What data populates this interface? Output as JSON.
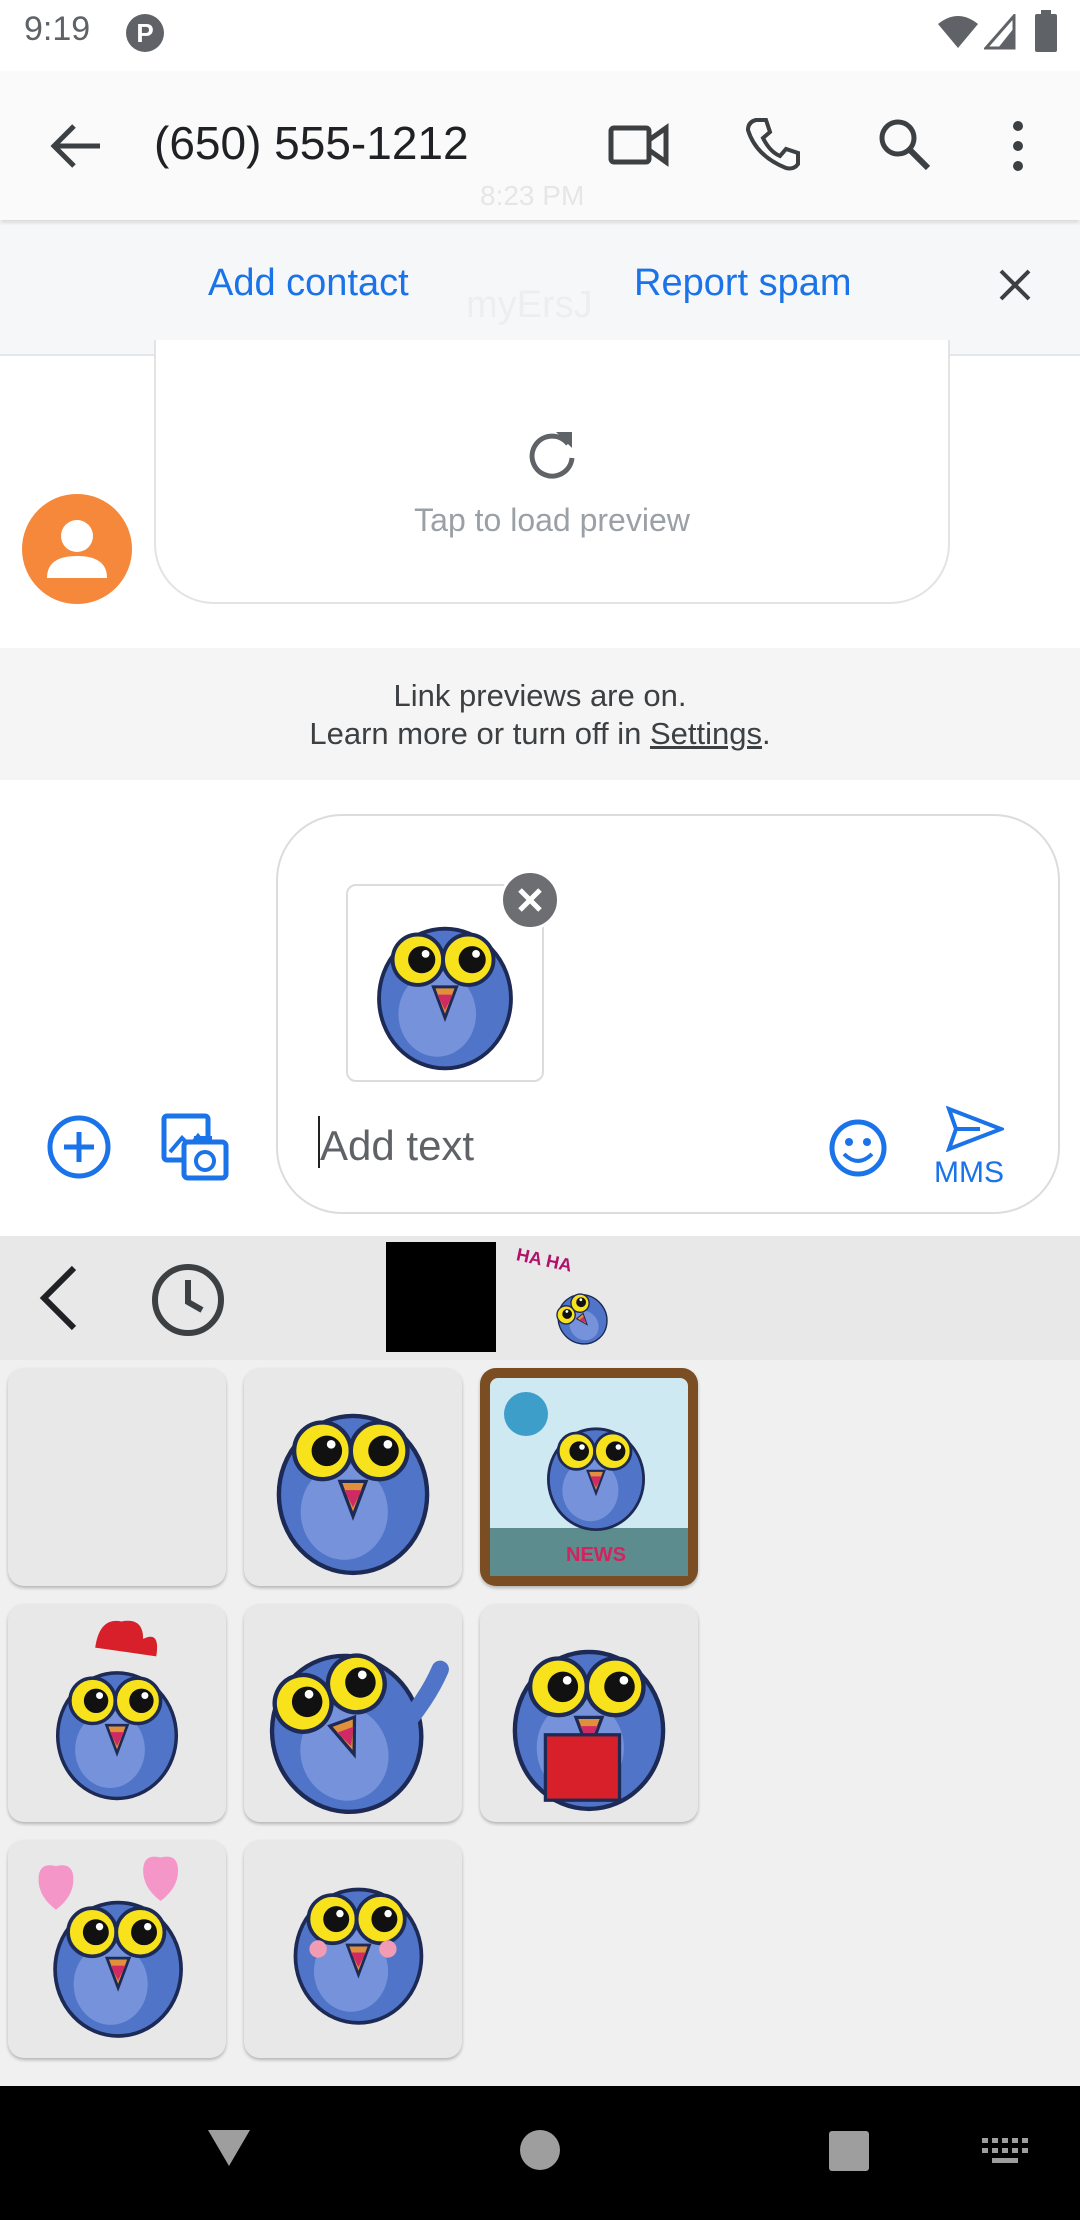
{
  "status_bar": {
    "time": "9:19",
    "notification_icon": "p-icon",
    "icons": [
      "wifi-icon",
      "signal-icon",
      "battery-icon"
    ]
  },
  "app_bar": {
    "title": "(650) 555-1212",
    "ghost_time": "8:23 PM",
    "icons": [
      "back-arrow-icon",
      "video-call-icon",
      "phone-icon",
      "search-icon",
      "more-vert-icon"
    ]
  },
  "banner": {
    "add_contact": "Add contact",
    "report_spam": "Report spam",
    "ghost_text": "myErsJ"
  },
  "message": {
    "preview_text": "Tap to load preview"
  },
  "notice": {
    "line1": "Link previews are on.",
    "line2_prefix": "Learn more or turn off in ",
    "settings_link": "Settings",
    "line2_suffix": "."
  },
  "compose": {
    "placeholder": "Add text",
    "send_label": "MMS"
  },
  "sticker_tabs": {
    "recent_pack_caption": "HA HA"
  },
  "sticker_grid": [
    {
      "name": "sticker-empty"
    },
    {
      "name": "sticker-owl-surprised"
    },
    {
      "name": "sticker-owl-news",
      "caption": "NEWS"
    },
    {
      "name": "sticker-owl-rooster"
    },
    {
      "name": "sticker-owl-waving"
    },
    {
      "name": "sticker-owl-reading"
    },
    {
      "name": "sticker-owl-hearts"
    },
    {
      "name": "sticker-owl-shy"
    }
  ],
  "colors": {
    "accent": "#1a73e8",
    "avatar": "#f5883a",
    "owl_body": "#4f74c8",
    "owl_eye": "#f7e21c"
  }
}
